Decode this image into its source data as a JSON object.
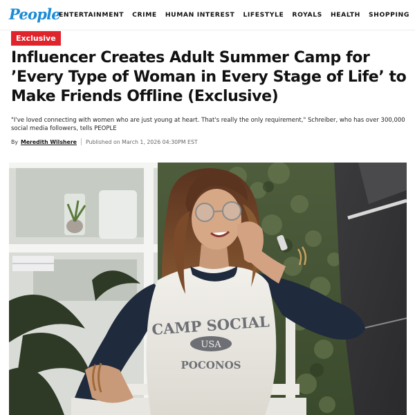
{
  "site": {
    "logo_text": "People",
    "brand_color": "#1b8bd6"
  },
  "nav": {
    "items": [
      "ENTERTAINMENT",
      "CRIME",
      "HUMAN INTEREST",
      "LIFESTYLE",
      "ROYALS",
      "HEALTH",
      "SHOPPING"
    ]
  },
  "article": {
    "badge": "Exclusive",
    "badge_color": "#e0242b",
    "headline": "Influencer Creates Adult Summer Camp for ’Every Type of Woman in Every Stage of Life’ to Make Friends Offline (Exclusive)",
    "dek": "\"I've loved connecting with women who are just young at heart. That's really the only requirement,\" Schreiber, who has over 300,000 social media followers, tells PEOPLE",
    "byline_prefix": "By",
    "author": "Meredith Wilshere",
    "published": "Published on March 1, 2026 04:30PM EST"
  },
  "hero": {
    "shirt_line1": "CAMP SOCIAL",
    "shirt_oval": "USA",
    "shirt_line3": "POCONOS"
  }
}
